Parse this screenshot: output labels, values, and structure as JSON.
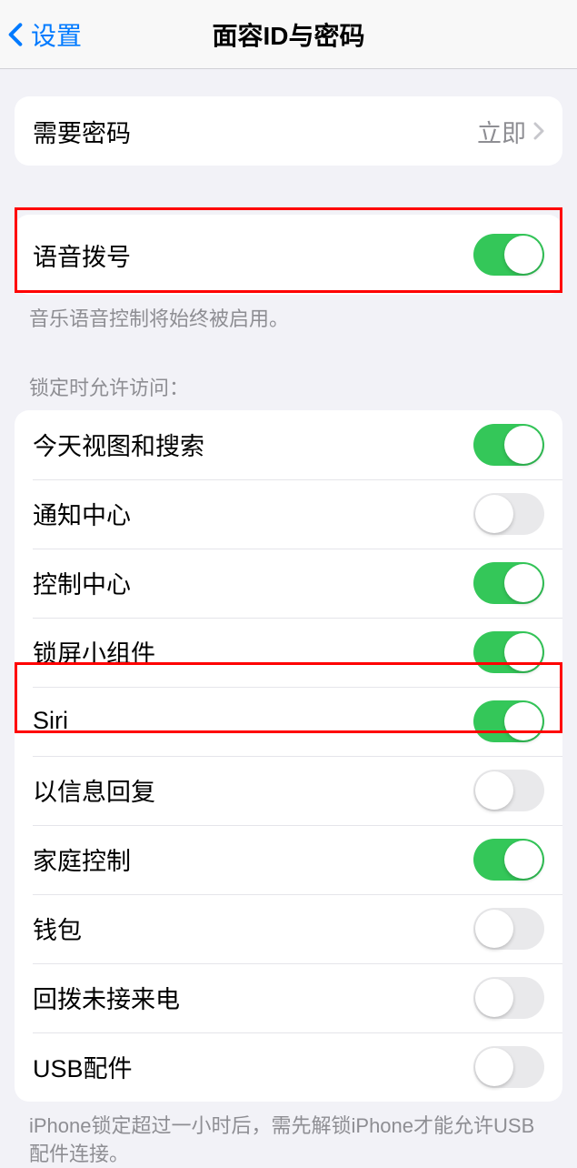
{
  "nav": {
    "back_label": "设置",
    "title": "面容ID与密码"
  },
  "group1": {
    "require_passcode": {
      "label": "需要密码",
      "value": "立即"
    }
  },
  "group2": {
    "voice_dial": {
      "label": "语音拨号",
      "on": true
    },
    "footer": "音乐语音控制将始终被启用。"
  },
  "group3": {
    "header": "锁定时允许访问：",
    "items": [
      {
        "key": "today",
        "label": "今天视图和搜索",
        "on": true
      },
      {
        "key": "notification-center",
        "label": "通知中心",
        "on": false
      },
      {
        "key": "control-center",
        "label": "控制中心",
        "on": true
      },
      {
        "key": "lock-screen-widgets",
        "label": "锁屏小组件",
        "on": true
      },
      {
        "key": "siri",
        "label": "Siri",
        "on": true
      },
      {
        "key": "reply-messages",
        "label": "以信息回复",
        "on": false
      },
      {
        "key": "home-control",
        "label": "家庭控制",
        "on": true
      },
      {
        "key": "wallet",
        "label": "钱包",
        "on": false
      },
      {
        "key": "return-missed",
        "label": "回拨未接来电",
        "on": false
      },
      {
        "key": "usb-accessories",
        "label": "USB配件",
        "on": false
      }
    ],
    "footer": "iPhone锁定超过一小时后，需先解锁iPhone才能允许USB配件连接。"
  }
}
